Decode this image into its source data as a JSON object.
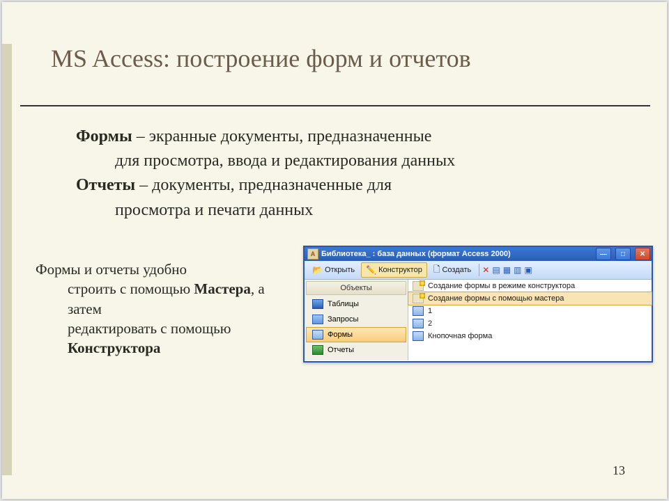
{
  "title": "MS Access: построение форм и отчетов",
  "defs": {
    "form_term": "Формы",
    "form_text1": " – экранные документы, предназначенные",
    "form_text2": "для просмотра, ввода и редактирования данных",
    "report_term": "Отчеты",
    "report_text1": " – документы, предназначенные для",
    "report_text2": "просмотра и печати данных"
  },
  "hint": {
    "line1": "Формы и отчеты удобно",
    "line2a": "строить с помощью ",
    "line2b": "Мастера",
    "line2c": ", а затем",
    "line3": "редактировать с помощью",
    "line4": "Конструктора"
  },
  "win": {
    "title": "Библиотека_ : база данных (формат Access 2000)",
    "toolbar": {
      "open": "Открыть",
      "designer": "Конструктор",
      "create": "Создать"
    },
    "nav": {
      "header": "Объекты",
      "items": [
        "Таблицы",
        "Запросы",
        "Формы",
        "Отчеты"
      ],
      "selected_index": 2
    },
    "list": [
      "Создание формы в режиме конструктора",
      "Создание формы с помощью мастера",
      "1",
      "2",
      "Кнопочная форма"
    ],
    "list_selected_index": 1
  },
  "page_number": "13"
}
